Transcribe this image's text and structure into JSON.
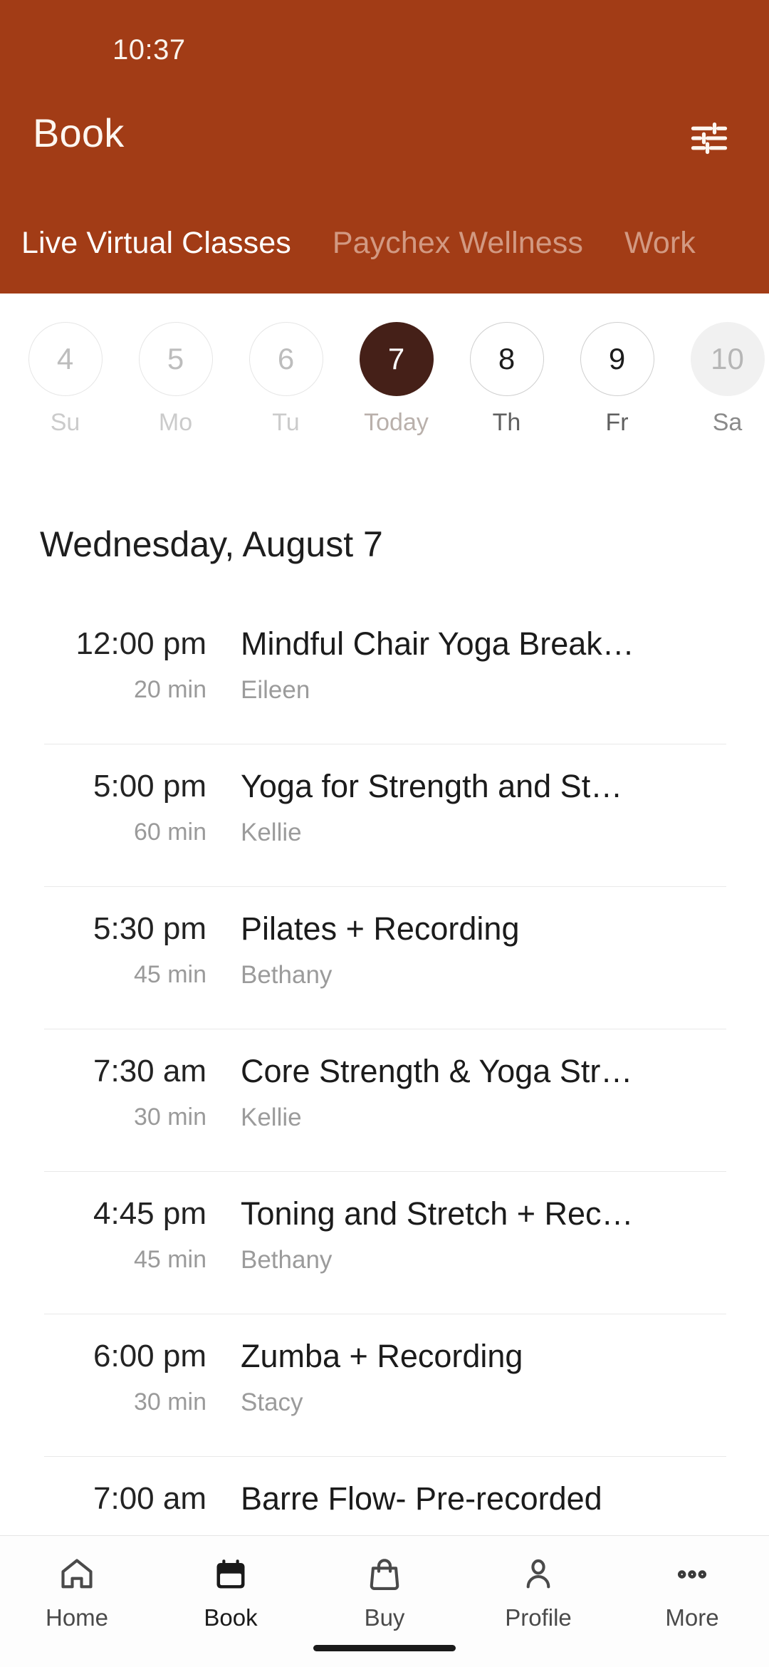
{
  "status_bar": {
    "time": "10:37"
  },
  "header": {
    "title": "Book",
    "filter_icon": "tune-filter-icon",
    "bg_color": "#A23C16",
    "tabs": [
      {
        "label": "Live Virtual Classes",
        "active": true
      },
      {
        "label": "Paychex Wellness",
        "active": false
      },
      {
        "label": "Work",
        "active": false
      }
    ]
  },
  "date_strip": {
    "accent_color": "#452018",
    "days": [
      {
        "num": "4",
        "label": "Su",
        "state": "past"
      },
      {
        "num": "5",
        "label": "Mo",
        "state": "past"
      },
      {
        "num": "6",
        "label": "Tu",
        "state": "past"
      },
      {
        "num": "7",
        "label": "Today",
        "state": "selected"
      },
      {
        "num": "8",
        "label": "Th",
        "state": "enabled"
      },
      {
        "num": "9",
        "label": "Fr",
        "state": "enabled"
      },
      {
        "num": "10",
        "label": "Sa",
        "state": "muted"
      }
    ]
  },
  "schedule": {
    "date_heading": "Wednesday, August 7",
    "classes": [
      {
        "time": "12:00 pm",
        "duration": "20 min",
        "title": "Mindful Chair Yoga Break…",
        "instructor": "Eileen"
      },
      {
        "time": "5:00 pm",
        "duration": "60 min",
        "title": "Yoga for Strength and St…",
        "instructor": "Kellie"
      },
      {
        "time": "5:30 pm",
        "duration": "45 min",
        "title": "Pilates + Recording",
        "instructor": "Bethany"
      },
      {
        "time": "7:30 am",
        "duration": "30 min",
        "title": "Core Strength & Yoga Str…",
        "instructor": "Kellie"
      },
      {
        "time": "4:45 pm",
        "duration": "45 min",
        "title": "Toning and Stretch + Rec…",
        "instructor": "Bethany"
      },
      {
        "time": "6:00 pm",
        "duration": "30 min",
        "title": "Zumba + Recording",
        "instructor": "Stacy"
      },
      {
        "time": "7:00 am",
        "duration": "",
        "title": "Barre Flow- Pre-recorded",
        "instructor": ""
      }
    ]
  },
  "bottom_nav": {
    "items": [
      {
        "label": "Home",
        "icon": "home-icon",
        "active": false
      },
      {
        "label": "Book",
        "icon": "calendar-icon",
        "active": true
      },
      {
        "label": "Buy",
        "icon": "bag-icon",
        "active": false
      },
      {
        "label": "Profile",
        "icon": "person-icon",
        "active": false
      },
      {
        "label": "More",
        "icon": "ellipsis-icon",
        "active": false
      }
    ]
  }
}
